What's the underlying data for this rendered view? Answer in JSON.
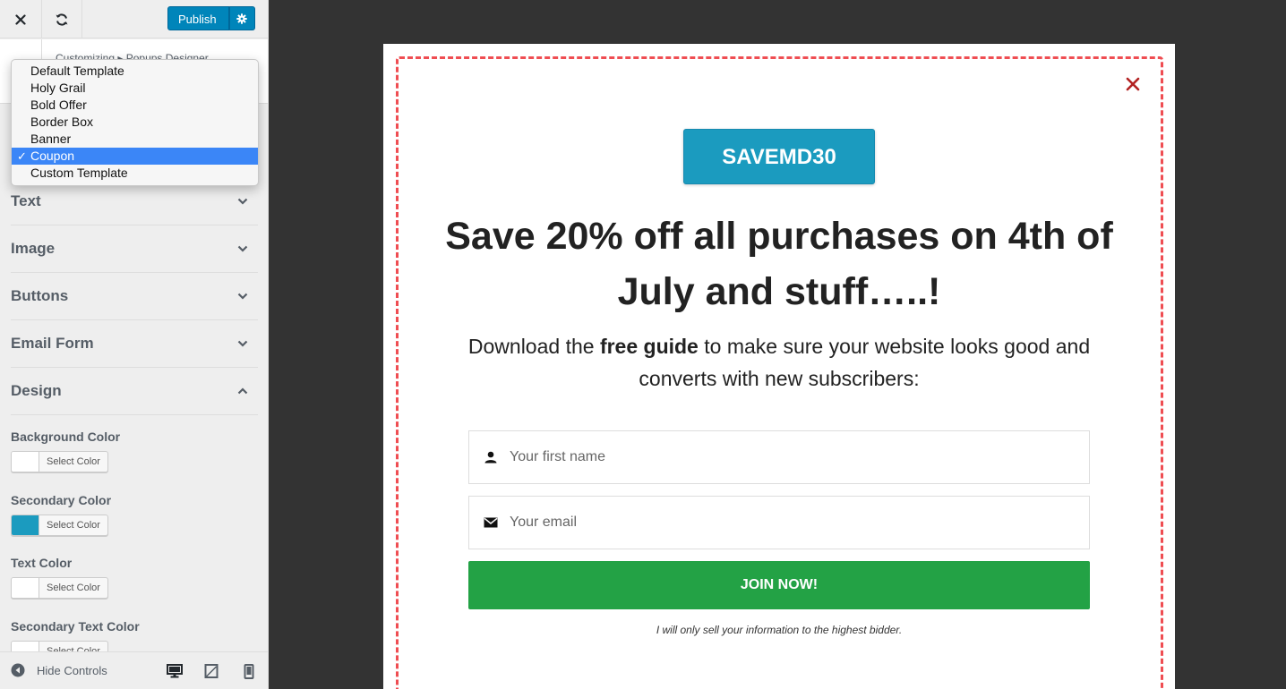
{
  "topbar": {
    "publish_label": "Publish"
  },
  "breadcrumb": {
    "text": "Customizing ▸ Popups Designer"
  },
  "template_dropdown": {
    "options": [
      "Default Template",
      "Holy Grail",
      "Bold Offer",
      "Border Box",
      "Banner",
      "Coupon",
      "Custom Template"
    ],
    "selected": "Coupon",
    "check_mark": "✓"
  },
  "sections": [
    {
      "label": "Text",
      "expanded": false
    },
    {
      "label": "Image",
      "expanded": false
    },
    {
      "label": "Buttons",
      "expanded": false
    },
    {
      "label": "Email Form",
      "expanded": false
    },
    {
      "label": "Design",
      "expanded": true
    }
  ],
  "design_controls": [
    {
      "label": "Background Color",
      "button": "Select Color",
      "swatch": "#ffffff"
    },
    {
      "label": "Secondary Color",
      "button": "Select Color",
      "swatch": "#1b9bbf"
    },
    {
      "label": "Text Color",
      "button": "Select Color",
      "swatch": "#ffffff"
    },
    {
      "label": "Secondary Text Color",
      "button": "Select Color",
      "swatch": "#ffffff"
    }
  ],
  "footer": {
    "hide_controls_label": "Hide Controls"
  },
  "popup": {
    "coupon_code": "SAVEMD30",
    "headline": "Save 20% off all purchases on 4th of July and stuff…..!",
    "sub_before": "Download the ",
    "sub_bold": "free guide",
    "sub_after": " to make sure your website looks good and converts with new subscribers:",
    "name_placeholder": "Your first name",
    "email_placeholder": "Your email",
    "join_label": "JOIN NOW!",
    "disclaimer": "I will only sell your information to the highest bidder."
  },
  "colors": {
    "publish": "#0085ba",
    "coupon": "#1b9bbf",
    "join": "#23a245",
    "dashed_border": "#ef4d52",
    "close_x": "#b22222",
    "preview_bg": "#333333"
  }
}
